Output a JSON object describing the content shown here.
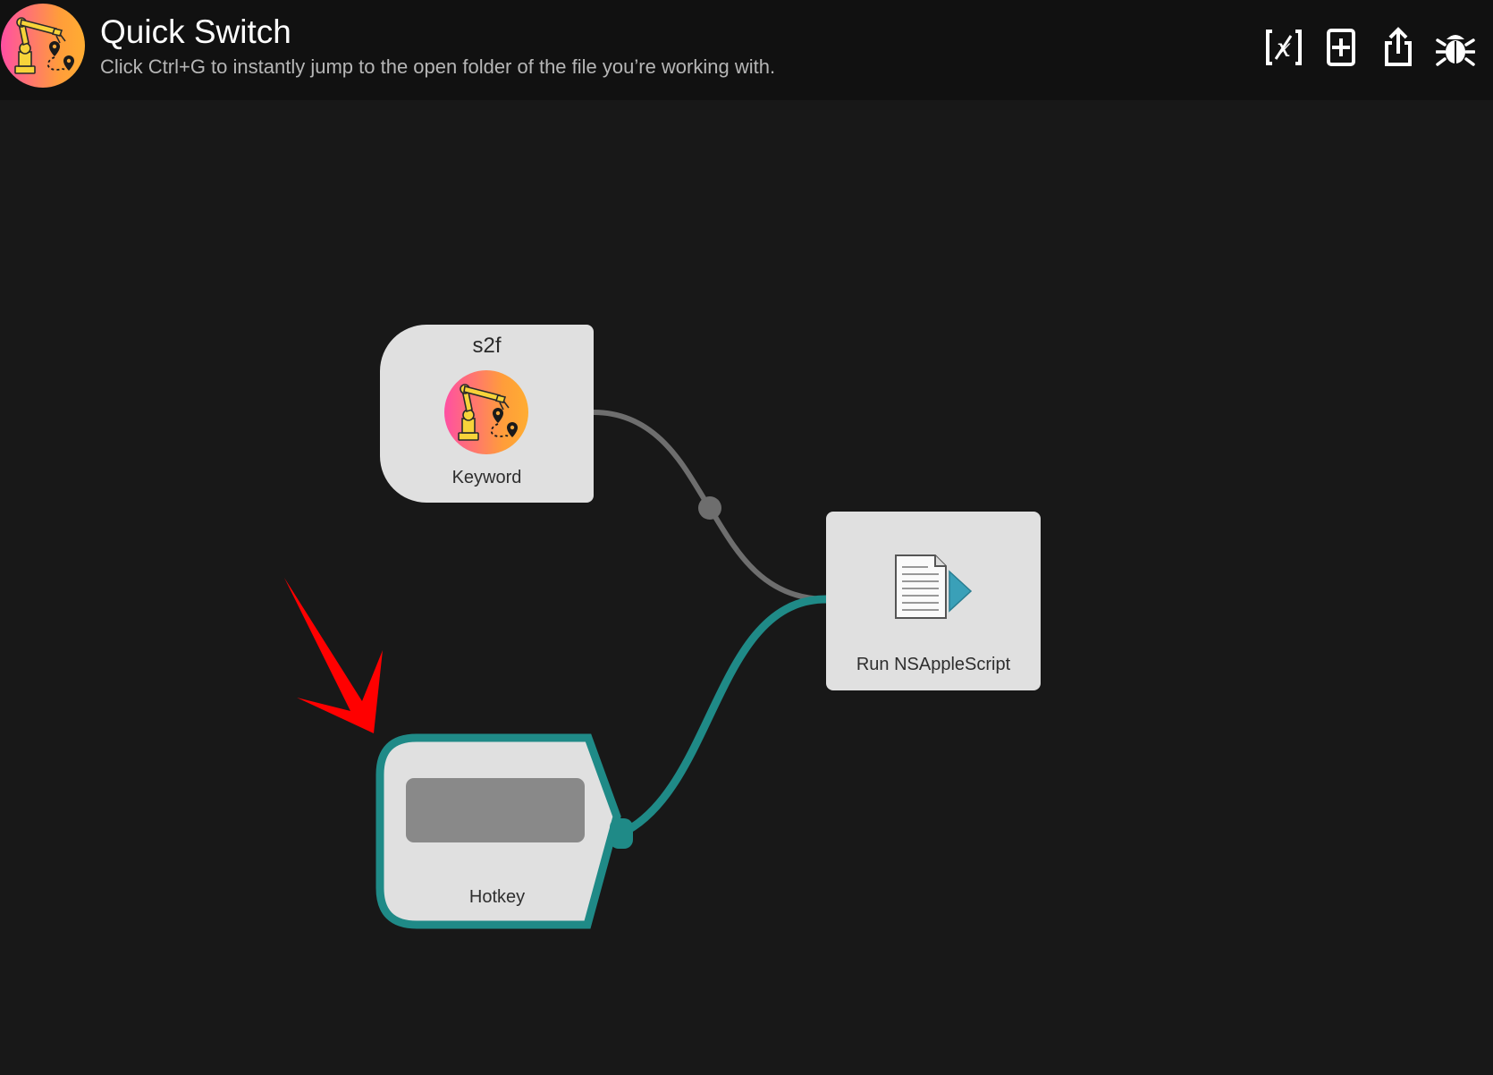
{
  "header": {
    "title": "Quick Switch",
    "subtitle": "Click Ctrl+G to instantly jump to the open folder of the file you’re working with.",
    "toolbar": [
      {
        "icon": "variables-icon"
      },
      {
        "icon": "add-object-icon"
      },
      {
        "icon": "share-icon"
      },
      {
        "icon": "debug-bug-icon"
      }
    ]
  },
  "colors": {
    "canvas_bg": "#181818",
    "header_bg": "#111111",
    "node_bg": "#e0e0e0",
    "selected_accent": "#1f8a87",
    "wire_gray": "#6e6e6e",
    "annotation_arrow": "#ff0000",
    "icon_gradient_start": "#ff4fa3",
    "icon_gradient_end": "#ffad32"
  },
  "nodes": {
    "keyword": {
      "top_label": "s2f",
      "label": "Keyword",
      "icon": "robot-arm-map-icon"
    },
    "run_script": {
      "label": "Run NSAppleScript",
      "icon": "applescript-document-icon"
    },
    "hotkey": {
      "label": "Hotkey",
      "selected": true,
      "hotkey_value": ""
    }
  },
  "annotation": {
    "icon": "red-arrow-pointer-icon"
  }
}
